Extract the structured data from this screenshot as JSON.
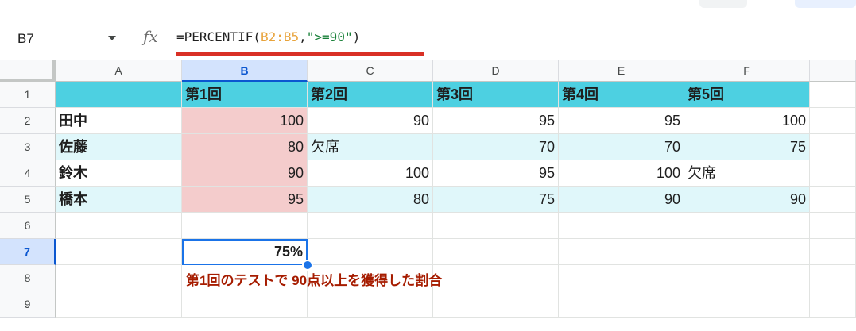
{
  "name_box": {
    "value": "B7"
  },
  "formula": {
    "prefix": "=PERCENTIF(",
    "range": "B2:B5",
    "comma": ",",
    "criteria": "\">=90\"",
    "suffix": ")"
  },
  "columns": [
    "A",
    "B",
    "C",
    "D",
    "E",
    "F"
  ],
  "rows": [
    "1",
    "2",
    "3",
    "4",
    "5",
    "6",
    "7",
    "8",
    "9"
  ],
  "header_cells": [
    "",
    "第1回",
    "第2回",
    "第3回",
    "第4回",
    "第5回"
  ],
  "data_rows": [
    {
      "name": "田中",
      "values": [
        "100",
        "90",
        "95",
        "95",
        "100"
      ]
    },
    {
      "name": "佐藤",
      "values": [
        "80",
        "欠席",
        "70",
        "70",
        "75"
      ]
    },
    {
      "name": "鈴木",
      "values": [
        "90",
        "100",
        "95",
        "100",
        "欠席"
      ]
    },
    {
      "name": "橋本",
      "values": [
        "95",
        "80",
        "75",
        "90",
        "90"
      ]
    }
  ],
  "result_cell": {
    "value": "75%"
  },
  "note": "第1回のテストで 90点以上を獲得した割合",
  "colors": {
    "header_fill": "#4dd0e1",
    "band_fill": "#e0f7fa",
    "highlight_fill": "#f4cccc",
    "selection": "#1a73e8",
    "note_text": "#a61c00",
    "underline": "#d93025"
  }
}
